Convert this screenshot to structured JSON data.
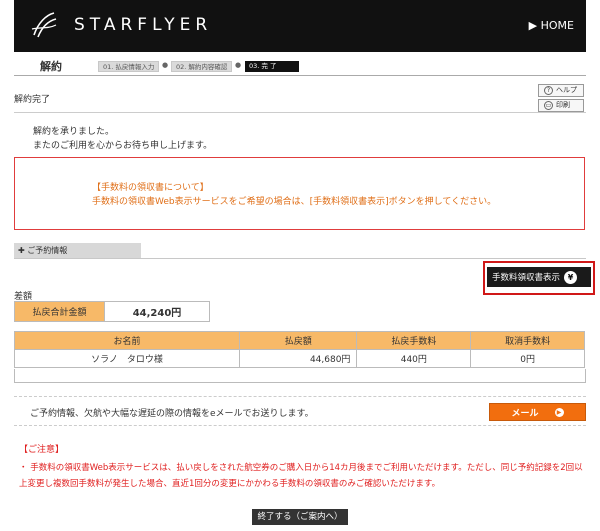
{
  "header": {
    "brand": "STARFLYER",
    "home": "▶ HOME"
  },
  "steps": {
    "title": "解約",
    "items": [
      "01. 払戻情報入力",
      "02. 解約内容確認",
      "03. 完 了"
    ]
  },
  "page": {
    "heading": "解約完了",
    "help": "ヘルプ",
    "print": "印刷",
    "message1": "解約を承りました。",
    "message2": "またのご利用を心からお待ち申し上げます。"
  },
  "notice": {
    "line1": "【手数料の領収書について】",
    "line2": "手数料の領収書Web表示サービスをご希望の場合は、[手数料領収書表示]ボタンを押してください。"
  },
  "section": {
    "tab": "ご予約情報",
    "receipt_button": "手数料領収書表示",
    "yen_symbol": "¥",
    "diff_label": "差額"
  },
  "total": {
    "label": "払戻合計金額",
    "value": "44,240円"
  },
  "table": {
    "headers": [
      "お名前",
      "払戻額",
      "払戻手数料",
      "取消手数料"
    ],
    "rows": [
      [
        "ソラノ　タロウ様",
        "44,680円",
        "440円",
        "0円"
      ]
    ]
  },
  "mail": {
    "text": "ご予約情報、欠航や大幅な遅延の際の情報をeメールでお送りします。",
    "button": "メール"
  },
  "caution": {
    "heading": "【ご注意】",
    "text": "・ 手数料の領収書Web表示サービスは、払い戻しをされた航空券のご購入日から14カ月後までご利用いただけます。ただし、同じ予約記録を2回以上変更し複数回手数料が発生した場合、直近1回分の変更にかかわる手数料の領収書のみご確認いただけます。"
  },
  "footer": {
    "end_button": "終了する（ご案内へ）"
  },
  "colors": {
    "header_bg": "#111111",
    "accent_orange": "#f26e0e",
    "table_header": "#f7b968",
    "caution_red": "#e02020"
  }
}
